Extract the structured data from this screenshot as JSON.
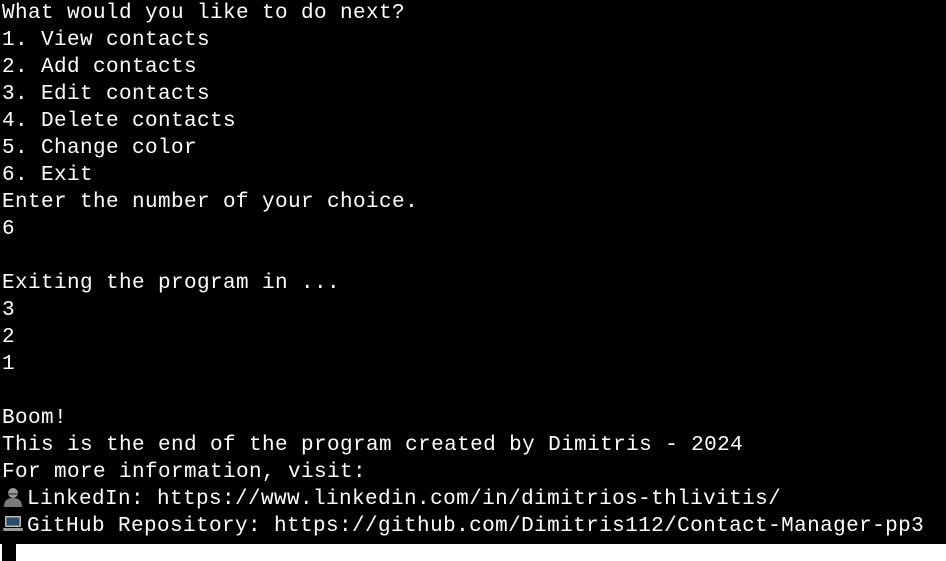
{
  "terminal": {
    "menu_prompt": "What would you like to do next?",
    "menu_items": [
      "1. View contacts",
      "2. Add contacts",
      "3. Edit contacts",
      "4. Delete contacts",
      "5. Change color",
      "6. Exit"
    ],
    "choice_prompt": "Enter the number of your choice.",
    "user_input": "6",
    "exit_message": "Exiting the program in ...",
    "countdown": [
      "3",
      "2",
      "1"
    ],
    "boom": "Boom!",
    "end_message": "This is the end of the program created by Dimitris - 2024",
    "info_message": "For more information, visit:",
    "linkedin_label": "LinkedIn: https://www.linkedin.com/in/dimitrios-thlivitis/",
    "github_label": "GitHub Repository: https://github.com/Dimitris112/Contact-Manager-pp3"
  },
  "icons": {
    "linkedin": "bust-silhouette-icon",
    "github": "laptop-icon"
  },
  "colors": {
    "background": "#000000",
    "text": "#ffffff"
  }
}
